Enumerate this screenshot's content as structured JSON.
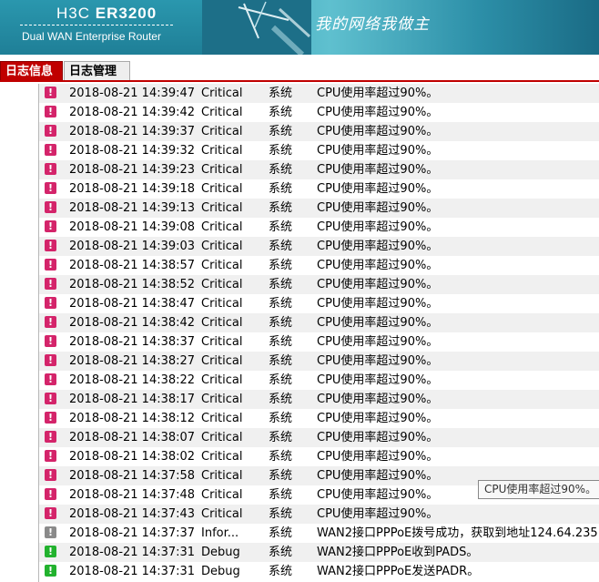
{
  "header": {
    "brand_prefix": "H3C",
    "brand_model": "ER3200",
    "subtitle": "Dual WAN Enterprise Router",
    "slogan": "我的网络我做主"
  },
  "tabs": [
    {
      "label": "日志信息",
      "active": true
    },
    {
      "label": "日志管理",
      "active": false
    }
  ],
  "level_colors": {
    "Critical": "#d4246a",
    "Infor...": "#8a8a8a",
    "Debug": "#22b22e"
  },
  "logs": [
    {
      "time": "2018-08-21 14:39:47",
      "level": "Critical",
      "source": "系统",
      "message": "CPU使用率超过90%。"
    },
    {
      "time": "2018-08-21 14:39:42",
      "level": "Critical",
      "source": "系统",
      "message": "CPU使用率超过90%。"
    },
    {
      "time": "2018-08-21 14:39:37",
      "level": "Critical",
      "source": "系统",
      "message": "CPU使用率超过90%。"
    },
    {
      "time": "2018-08-21 14:39:32",
      "level": "Critical",
      "source": "系统",
      "message": "CPU使用率超过90%。"
    },
    {
      "time": "2018-08-21 14:39:23",
      "level": "Critical",
      "source": "系统",
      "message": "CPU使用率超过90%。"
    },
    {
      "time": "2018-08-21 14:39:18",
      "level": "Critical",
      "source": "系统",
      "message": "CPU使用率超过90%。"
    },
    {
      "time": "2018-08-21 14:39:13",
      "level": "Critical",
      "source": "系统",
      "message": "CPU使用率超过90%。"
    },
    {
      "time": "2018-08-21 14:39:08",
      "level": "Critical",
      "source": "系统",
      "message": "CPU使用率超过90%。"
    },
    {
      "time": "2018-08-21 14:39:03",
      "level": "Critical",
      "source": "系统",
      "message": "CPU使用率超过90%。"
    },
    {
      "time": "2018-08-21 14:38:57",
      "level": "Critical",
      "source": "系统",
      "message": "CPU使用率超过90%。"
    },
    {
      "time": "2018-08-21 14:38:52",
      "level": "Critical",
      "source": "系统",
      "message": "CPU使用率超过90%。"
    },
    {
      "time": "2018-08-21 14:38:47",
      "level": "Critical",
      "source": "系统",
      "message": "CPU使用率超过90%。"
    },
    {
      "time": "2018-08-21 14:38:42",
      "level": "Critical",
      "source": "系统",
      "message": "CPU使用率超过90%。"
    },
    {
      "time": "2018-08-21 14:38:37",
      "level": "Critical",
      "source": "系统",
      "message": "CPU使用率超过90%。"
    },
    {
      "time": "2018-08-21 14:38:27",
      "level": "Critical",
      "source": "系统",
      "message": "CPU使用率超过90%。"
    },
    {
      "time": "2018-08-21 14:38:22",
      "level": "Critical",
      "source": "系统",
      "message": "CPU使用率超过90%。"
    },
    {
      "time": "2018-08-21 14:38:17",
      "level": "Critical",
      "source": "系统",
      "message": "CPU使用率超过90%。"
    },
    {
      "time": "2018-08-21 14:38:12",
      "level": "Critical",
      "source": "系统",
      "message": "CPU使用率超过90%。"
    },
    {
      "time": "2018-08-21 14:38:07",
      "level": "Critical",
      "source": "系统",
      "message": "CPU使用率超过90%。"
    },
    {
      "time": "2018-08-21 14:38:02",
      "level": "Critical",
      "source": "系统",
      "message": "CPU使用率超过90%。"
    },
    {
      "time": "2018-08-21 14:37:58",
      "level": "Critical",
      "source": "系统",
      "message": "CPU使用率超过90%。"
    },
    {
      "time": "2018-08-21 14:37:48",
      "level": "Critical",
      "source": "系统",
      "message": "CPU使用率超过90%。"
    },
    {
      "time": "2018-08-21 14:37:43",
      "level": "Critical",
      "source": "系统",
      "message": "CPU使用率超过90%。"
    },
    {
      "time": "2018-08-21 14:37:37",
      "level": "Infor...",
      "source": "系统",
      "message": "WAN2接口PPPoE拨号成功，获取到地址124.64.235...."
    },
    {
      "time": "2018-08-21 14:37:31",
      "level": "Debug",
      "source": "系统",
      "message": "WAN2接口PPPoE收到PADS。"
    },
    {
      "time": "2018-08-21 14:37:31",
      "level": "Debug",
      "source": "系统",
      "message": "WAN2接口PPPoE发送PADR。"
    }
  ],
  "tooltip": {
    "text": "CPU使用率超过90%。"
  }
}
